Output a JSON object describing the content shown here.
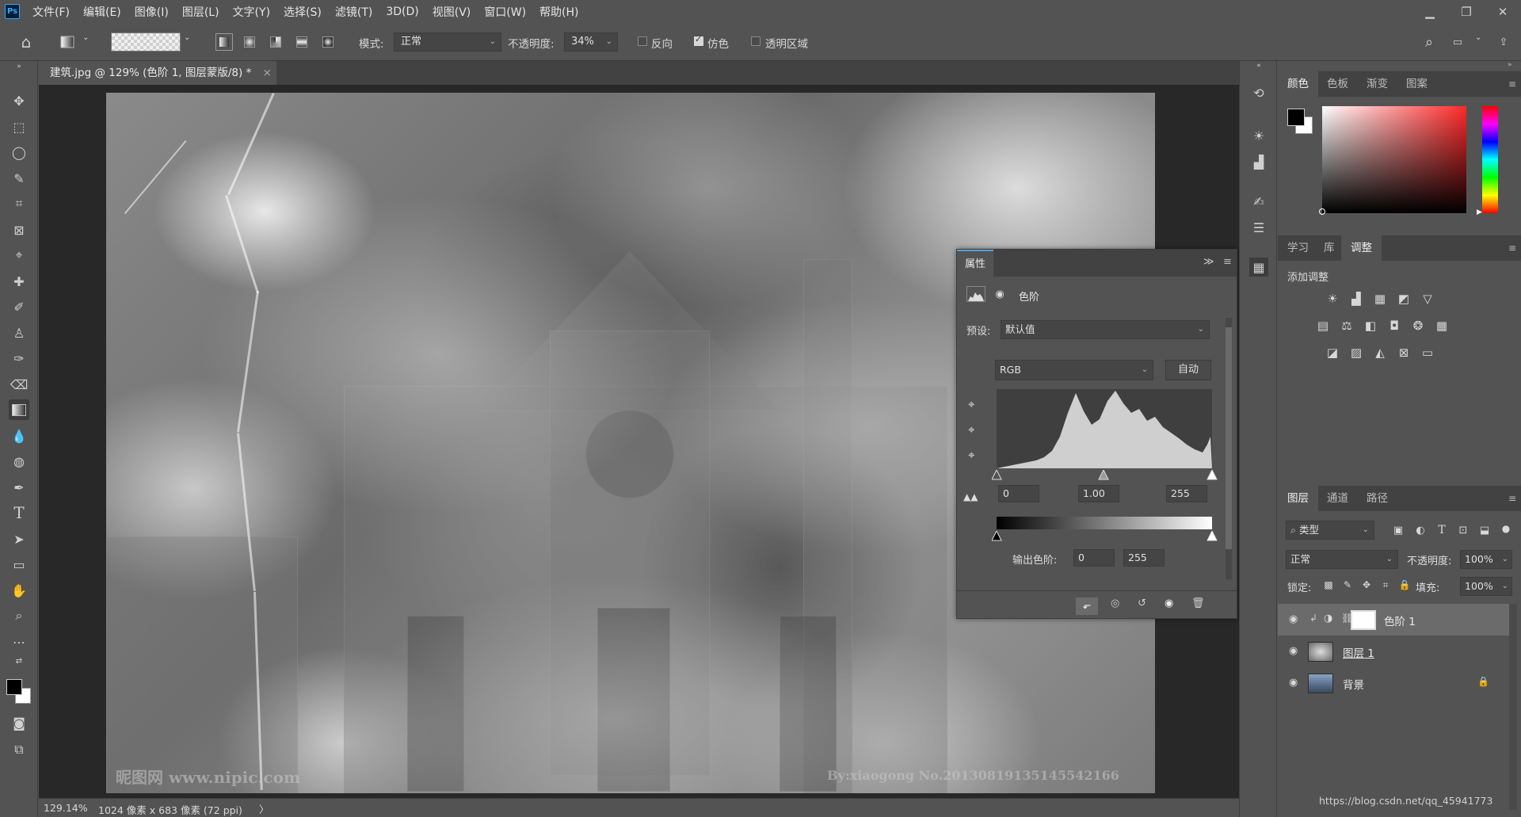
{
  "app": {
    "logo": "Ps",
    "menu": [
      "文件(F)",
      "编辑(E)",
      "图像(I)",
      "图层(L)",
      "文字(Y)",
      "选择(S)",
      "滤镜(T)",
      "3D(D)",
      "视图(V)",
      "窗口(W)",
      "帮助(H)"
    ],
    "win_controls": [
      "minimize-icon",
      "restore-icon",
      "close-icon"
    ]
  },
  "options": {
    "mode_label": "模式:",
    "mode_value": "正常",
    "opacity_label": "不透明度:",
    "opacity_value": "34%",
    "reverse_label": "反向",
    "reverse_checked": false,
    "dither_label": "仿色",
    "dither_checked": true,
    "transparency_label": "透明区域",
    "transparency_checked": false
  },
  "document": {
    "tab_title": "建筑.jpg @ 129% (色阶 1, 图层蒙版/8) *",
    "tab_close": "×",
    "watermark_left": "昵图网 www.nipic.com",
    "watermark_right": "By:xiaogong  No.20130819135145542166"
  },
  "status": {
    "zoom": "129.14%",
    "info": "1024 像素 x 683 像素 (72 ppi)",
    "arrow": "〉"
  },
  "properties": {
    "tab": "属性",
    "collapse": "≫",
    "title": "色阶",
    "preset_label": "预设:",
    "preset_value": "默认值",
    "channel_value": "RGB",
    "auto_label": "自动",
    "input_black": "0",
    "input_gamma": "1.00",
    "input_white": "255",
    "output_label": "输出色阶:",
    "output_black": "0",
    "output_white": "255"
  },
  "color_panel": {
    "tabs": [
      "颜色",
      "色板",
      "渐变",
      "图案"
    ],
    "active": 0,
    "hue_color": "#ff2a2a"
  },
  "adjust_panel": {
    "tabs": [
      "学习",
      "库",
      "调整"
    ],
    "active": 2,
    "title": "添加调整"
  },
  "layers_panel": {
    "tabs": [
      "图层",
      "通道",
      "路径"
    ],
    "active": 0,
    "filter_label": "类型",
    "blend_mode": "正常",
    "opacity_label": "不透明度:",
    "opacity_value": "100%",
    "lock_label": "锁定:",
    "fill_label": "填充:",
    "fill_value": "100%",
    "layers": [
      {
        "name": "色阶 1",
        "selected": true
      },
      {
        "name": "图层 1",
        "selected": false
      },
      {
        "name": "背景",
        "selected": false,
        "locked": true
      }
    ],
    "footer_text": "https://blog.csdn.net/qq_45941773"
  }
}
